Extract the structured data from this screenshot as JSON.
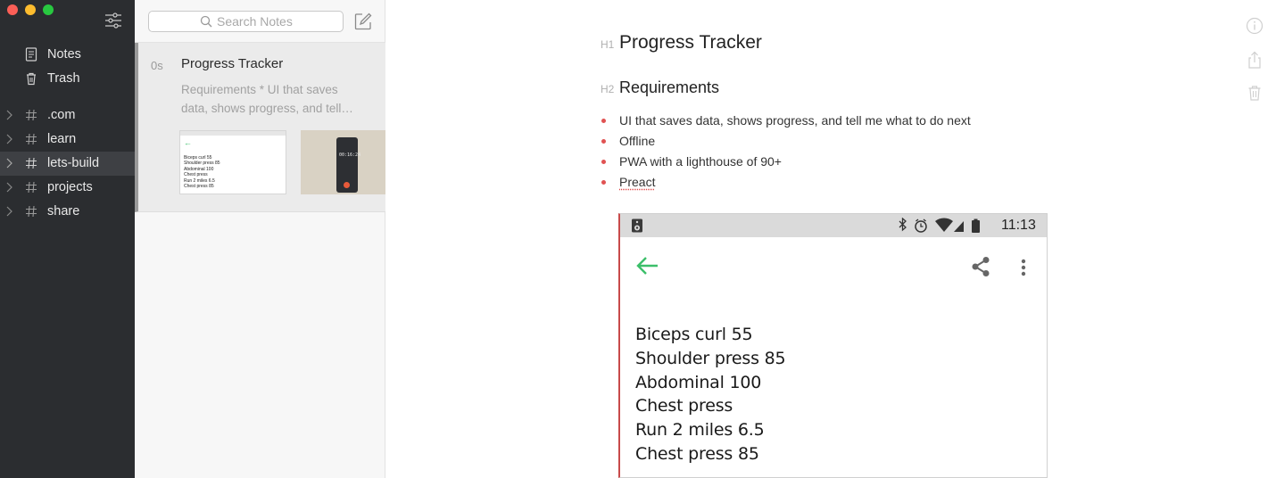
{
  "sidebar": {
    "items": [
      {
        "label": "Notes",
        "icon": "notes-icon"
      },
      {
        "label": "Trash",
        "icon": "trash-icon"
      }
    ],
    "tags": [
      {
        "label": ".com",
        "active": false
      },
      {
        "label": "learn",
        "active": false
      },
      {
        "label": "lets-build",
        "active": true
      },
      {
        "label": "projects",
        "active": false
      },
      {
        "label": "share",
        "active": false
      }
    ]
  },
  "notelist": {
    "search_placeholder": "Search Notes",
    "notes": [
      {
        "time": "0s",
        "title": "Progress Tracker",
        "preview_line1": "Requirements * UI that saves",
        "preview_line2": "data, shows progress, and tell…",
        "thumb_time": "00:16:24"
      }
    ]
  },
  "editor": {
    "h1_marker": "H1",
    "h2_marker": "H2",
    "title": "Progress Tracker",
    "subtitle": "Requirements",
    "bullets": [
      "UI that saves data, shows progress, and tell me what to do next",
      "Offline",
      "PWA with a lighthouse of 90+",
      "Preact"
    ],
    "screenshot": {
      "status_time": "11:13",
      "workout_items": [
        "Biceps curl 55",
        "Shoulder press 85",
        "Abdominal 100",
        "Chest press",
        "Run 2 miles 6.5",
        "Chest press 85"
      ]
    }
  },
  "colors": {
    "sidebar_bg": "#2b2d30",
    "bullet": "#e05252",
    "android_accent": "#3cbf6a"
  }
}
